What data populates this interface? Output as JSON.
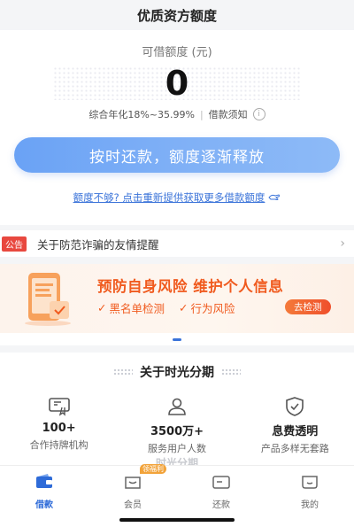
{
  "header": {
    "title": "优质资方额度"
  },
  "credit": {
    "label": "可借额度 (元)",
    "amount": "0",
    "rate": "综合年化18%~35.99%",
    "separator": "|",
    "notice_link": "借款须知",
    "info_glyph": "i"
  },
  "actions": {
    "repay_button": "按时还款，额度逐渐释放",
    "more_link": "额度不够? 点击重新提供获取更多借款额度",
    "hand_icon": "hand-pointer-icon"
  },
  "notice": {
    "tag": "公告",
    "text": "关于防范诈骗的友情提醒",
    "chevron": "›"
  },
  "banner": {
    "title": "预防自身风险  维护个人信息",
    "item1": "黑名单检测",
    "item2": "行为风险",
    "button": "去检测",
    "check_glyph": "✓",
    "accent": "#f05a1e"
  },
  "about": {
    "title": "关于时光分期",
    "stats": [
      {
        "value": "100+",
        "desc": "合作持牌机构",
        "icon": "license-icon"
      },
      {
        "value": "3500万+",
        "desc": "服务用户人数",
        "icon": "user-icon"
      },
      {
        "value": "息费透明",
        "desc": "产品多样无套路",
        "icon": "shield-check-icon"
      }
    ]
  },
  "footer": {
    "logo_text": "时光分期"
  },
  "tabbar": {
    "items": [
      {
        "label": "借款",
        "icon": "wallet-icon",
        "active": true
      },
      {
        "label": "会员",
        "icon": "member-icon",
        "badge": "领福利"
      },
      {
        "label": "还款",
        "icon": "card-icon"
      },
      {
        "label": "我的",
        "icon": "profile-icon"
      }
    ],
    "active_color": "#2e6bd8"
  }
}
